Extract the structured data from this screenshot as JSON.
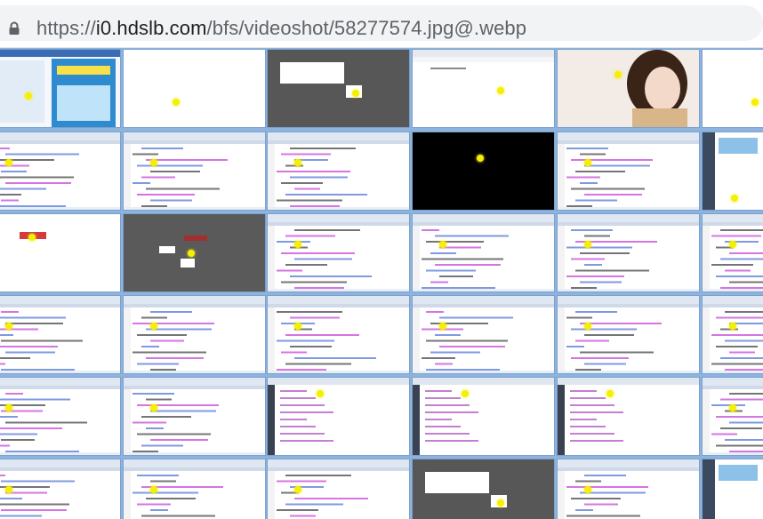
{
  "browser": {
    "url_scheme": "https://",
    "url_host": "i0.hdslb.com",
    "url_path": "/bfs/videoshot/58277574.jpg@.webp",
    "lock_icon": "lock-icon"
  },
  "thumbnails": {
    "rows": 6,
    "cols": 6,
    "grid_color": "#8eb3dd",
    "highlight_color": "#f5f000",
    "tiles": [
      {
        "kind": "web-ad"
      },
      {
        "kind": "blank"
      },
      {
        "kind": "dark-dialog"
      },
      {
        "kind": "browser"
      },
      {
        "kind": "portrait"
      },
      {
        "kind": "blank"
      },
      {
        "kind": "code"
      },
      {
        "kind": "code"
      },
      {
        "kind": "code"
      },
      {
        "kind": "black"
      },
      {
        "kind": "code"
      },
      {
        "kind": "sidebar-app"
      },
      {
        "kind": "baidu"
      },
      {
        "kind": "dark-baidu"
      },
      {
        "kind": "code"
      },
      {
        "kind": "code"
      },
      {
        "kind": "code"
      },
      {
        "kind": "code"
      },
      {
        "kind": "code"
      },
      {
        "kind": "code"
      },
      {
        "kind": "code"
      },
      {
        "kind": "code"
      },
      {
        "kind": "code"
      },
      {
        "kind": "code"
      },
      {
        "kind": "code"
      },
      {
        "kind": "code"
      },
      {
        "kind": "devtools"
      },
      {
        "kind": "devtools"
      },
      {
        "kind": "devtools"
      },
      {
        "kind": "code"
      },
      {
        "kind": "code"
      },
      {
        "kind": "code"
      },
      {
        "kind": "code"
      },
      {
        "kind": "dark-dialog"
      },
      {
        "kind": "code"
      },
      {
        "kind": "sidebar-app"
      }
    ]
  }
}
